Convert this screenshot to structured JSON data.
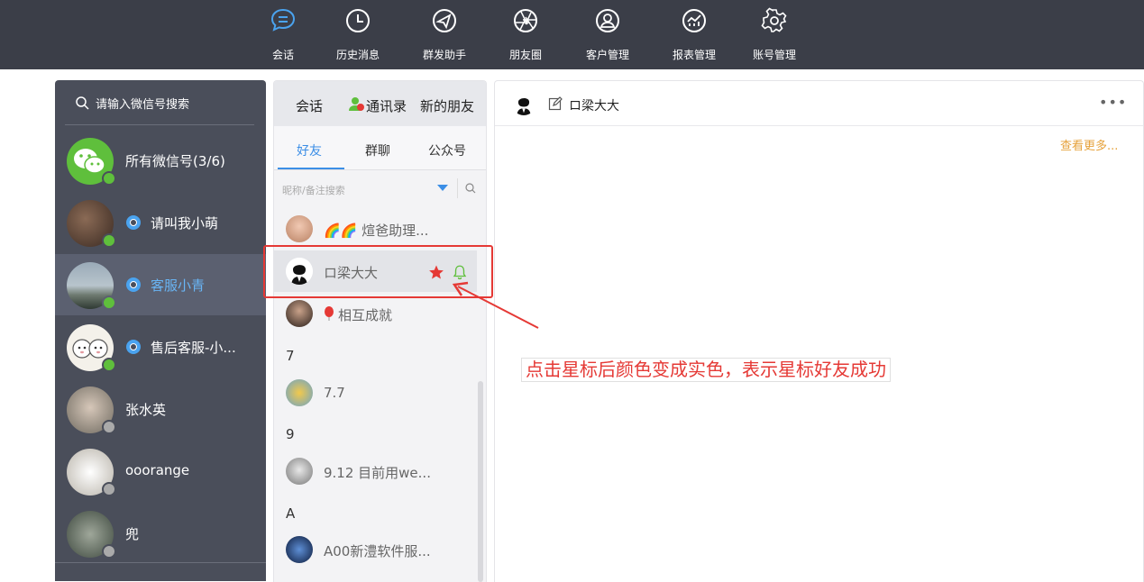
{
  "nav": {
    "items": [
      {
        "label": "会话",
        "icon": "chat-bubble-icon",
        "active": true
      },
      {
        "label": "历史消息",
        "icon": "clock-icon"
      },
      {
        "label": "群发助手",
        "icon": "paper-plane-icon"
      },
      {
        "label": "朋友圈",
        "icon": "aperture-icon"
      },
      {
        "label": "客户管理",
        "icon": "customer-icon"
      },
      {
        "label": "报表管理",
        "icon": "report-chart-icon"
      },
      {
        "label": "账号管理",
        "icon": "gear-icon"
      }
    ],
    "active_color": "#4aa3ef"
  },
  "accounts": {
    "search_placeholder": "请输入微信号搜索",
    "items": [
      {
        "name": "所有微信号(3/6)",
        "status": "online",
        "avatar": "wechat-logo"
      },
      {
        "name": "请叫我小萌",
        "status": "online",
        "avatar": "user-photo"
      },
      {
        "name": "客服小青",
        "status": "online",
        "selected": true,
        "avatar": "user-photo"
      },
      {
        "name": "售后客服-小...",
        "status": "online",
        "avatar": "user-photo"
      },
      {
        "name": "张水英",
        "status": "offline",
        "avatar": "user-photo"
      },
      {
        "name": "ooorange",
        "status": "offline",
        "avatar": "user-photo"
      },
      {
        "name": "兜",
        "status": "offline",
        "avatar": "user-photo"
      }
    ]
  },
  "contacts": {
    "tabs": [
      "会话",
      "通讯录",
      "新的朋友"
    ],
    "subtabs": [
      "好友",
      "群聊",
      "公众号"
    ],
    "active_subtab": "好友",
    "filter_placeholder": "昵称/备注搜索",
    "list": [
      {
        "name": "🌈🌈 煊爸助理..."
      },
      {
        "name": "ロ梁大大",
        "starred": true,
        "highlighted": true
      },
      {
        "name": "相互成就",
        "prefix_icon": "balloon"
      }
    ],
    "sections": [
      {
        "header": "7",
        "items": [
          "7.7"
        ]
      },
      {
        "header": "9",
        "items": [
          "9.12 目前用we..."
        ]
      },
      {
        "header": "A",
        "items": [
          "A00新澧软件服..."
        ]
      }
    ]
  },
  "chat": {
    "title": "ロ梁大大",
    "more": "•••",
    "see_more": "查看更多..."
  },
  "annotation": {
    "text": "点击星标后颜色变成实色，表示星标好友成功",
    "color": "#e53935"
  }
}
